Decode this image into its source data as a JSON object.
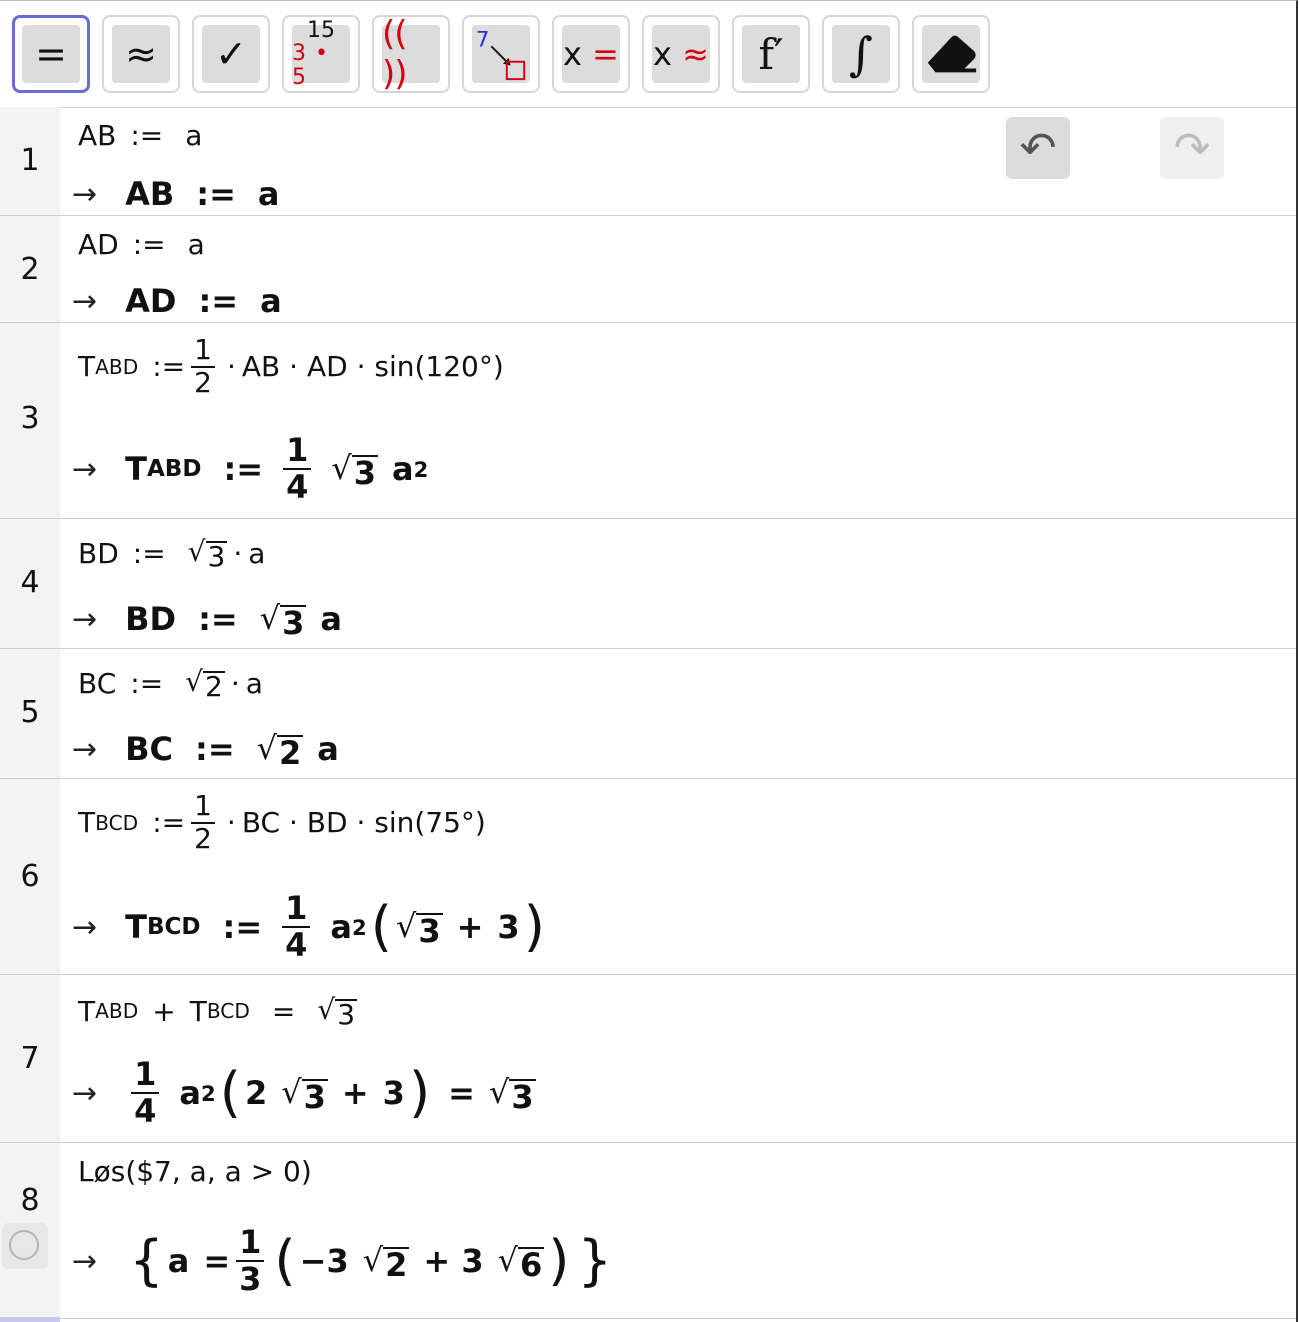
{
  "toolbar": {
    "buttons": [
      {
        "id": "evaluate",
        "glyph": "="
      },
      {
        "id": "numeric",
        "glyph": "≈"
      },
      {
        "id": "keep-input",
        "glyph": "✓"
      },
      {
        "id": "factor-top",
        "glyph": "15"
      },
      {
        "id": "factor-bottom-a",
        "glyph": "3"
      },
      {
        "id": "factor-bottom-b",
        "glyph": "5"
      },
      {
        "id": "expand",
        "glyph": "(( ))"
      },
      {
        "id": "substitute-number",
        "glyph": "7"
      },
      {
        "id": "solve-x",
        "glyph": "x"
      },
      {
        "id": "solve-eq",
        "glyph": "="
      },
      {
        "id": "nsolve-x",
        "glyph": "x"
      },
      {
        "id": "nsolve-eq",
        "glyph": "≈"
      },
      {
        "id": "derivative",
        "glyph": "f′"
      },
      {
        "id": "integral",
        "glyph": "∫"
      }
    ]
  },
  "rows": {
    "r1": {
      "num": "1",
      "in_lhs": "AB",
      "assign": ":=",
      "in_rhs": "a",
      "out_lhs": "AB",
      "out_rhs": "a"
    },
    "r2": {
      "num": "2",
      "in_lhs": "AD",
      "assign": ":=",
      "in_rhs": "a",
      "out_lhs": "AD",
      "out_rhs": "a"
    },
    "r3": {
      "num": "3",
      "in_T": "T",
      "in_sub": "ABD",
      "in_num": "1",
      "in_den": "2",
      "in_rest": "AB · AD · sin(120°)",
      "out_T": "T",
      "out_sub": "ABD",
      "out_num": "1",
      "out_den": "4",
      "out_rad": "3",
      "out_var": "a",
      "out_exp": "2"
    },
    "r4": {
      "num": "4",
      "in_lhs": "BD",
      "in_rad": "3",
      "in_var": "a",
      "out_lhs": "BD",
      "out_rad": "3",
      "out_var": "a"
    },
    "r5": {
      "num": "5",
      "in_lhs": "BC",
      "in_rad": "2",
      "in_var": "a",
      "out_lhs": "BC",
      "out_rad": "2",
      "out_var": "a"
    },
    "r6": {
      "num": "6",
      "in_T": "T",
      "in_sub": "BCD",
      "in_num": "1",
      "in_den": "2",
      "in_rest": "BC · BD · sin(75°)",
      "out_T": "T",
      "out_sub": "BCD",
      "out_num": "1",
      "out_den": "4",
      "out_var": "a",
      "out_exp": "2",
      "out_rad": "3",
      "out_plus": "+",
      "out_const": "3"
    },
    "r7": {
      "num": "7",
      "in_T1": "T",
      "in_sub1": "ABD",
      "in_plus": "+",
      "in_T2": "T",
      "in_sub2": "BCD",
      "in_eq": "=",
      "in_rad": "3",
      "out_num": "1",
      "out_den": "4",
      "out_var": "a",
      "out_exp": "2",
      "out_coef": "2",
      "out_rad": "3",
      "out_plus": "+",
      "out_const": "3",
      "out_eq": "=",
      "out_rhs_rad": "3"
    },
    "r8": {
      "num": "8",
      "in_text": "Løs($7,  a,  a > 0)",
      "out_var": "a",
      "out_eq": "=",
      "out_num": "1",
      "out_den": "3",
      "out_minus": "−3",
      "out_rad1": "2",
      "out_plus": "+ 3",
      "out_rad2": "6"
    }
  },
  "arrow": "→",
  "dot": "·",
  "undo_glyph": "↶",
  "redo_glyph": "↷"
}
